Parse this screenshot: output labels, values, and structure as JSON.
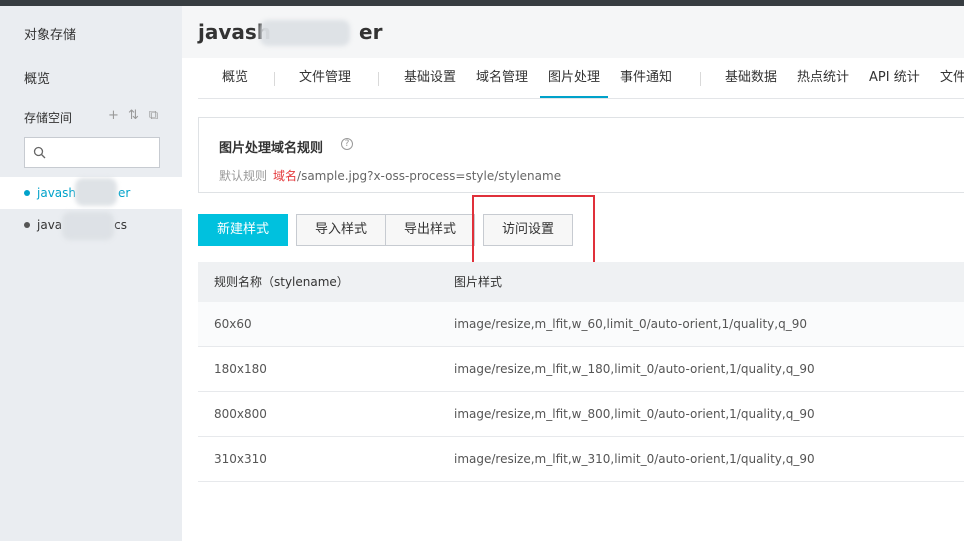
{
  "sidebar": {
    "title": "对象存储",
    "overview": "概览",
    "space_label": "存储空间",
    "tools": [
      "+",
      "⇅",
      "⧉"
    ],
    "buckets": [
      {
        "label": "javash",
        "suffix": "er",
        "active": true
      },
      {
        "label": "java",
        "suffix": "cs",
        "active": false
      }
    ]
  },
  "header": {
    "title_prefix": "javash",
    "title_suffix": "er"
  },
  "tabs": [
    "概览",
    "文件管理",
    "基础设置",
    "域名管理",
    "图片处理",
    "事件通知",
    "基础数据",
    "热点统计",
    "API 统计",
    "文件"
  ],
  "rule": {
    "title": "图片处理域名规则",
    "default_label": "默认规则",
    "domain": "域名",
    "path": "/sample.jpg?x-oss-process=style/stylename"
  },
  "buttons": {
    "new_style": "新建样式",
    "import_style": "导入样式",
    "export_style": "导出样式",
    "access_settings": "访问设置"
  },
  "table": {
    "headers": [
      "规则名称（stylename）",
      "图片样式"
    ],
    "rows": [
      [
        "60x60",
        "image/resize,m_lfit,w_60,limit_0/auto-orient,1/quality,q_90"
      ],
      [
        "180x180",
        "image/resize,m_lfit,w_180,limit_0/auto-orient,1/quality,q_90"
      ],
      [
        "800x800",
        "image/resize,m_lfit,w_800,limit_0/auto-orient,1/quality,q_90"
      ],
      [
        "310x310",
        "image/resize,m_lfit,w_310,limit_0/auto-orient,1/quality,q_90"
      ]
    ]
  },
  "colors": {
    "accent": "#00c1de",
    "highlight": "#e0303a",
    "active_text": "#00a2ca"
  }
}
